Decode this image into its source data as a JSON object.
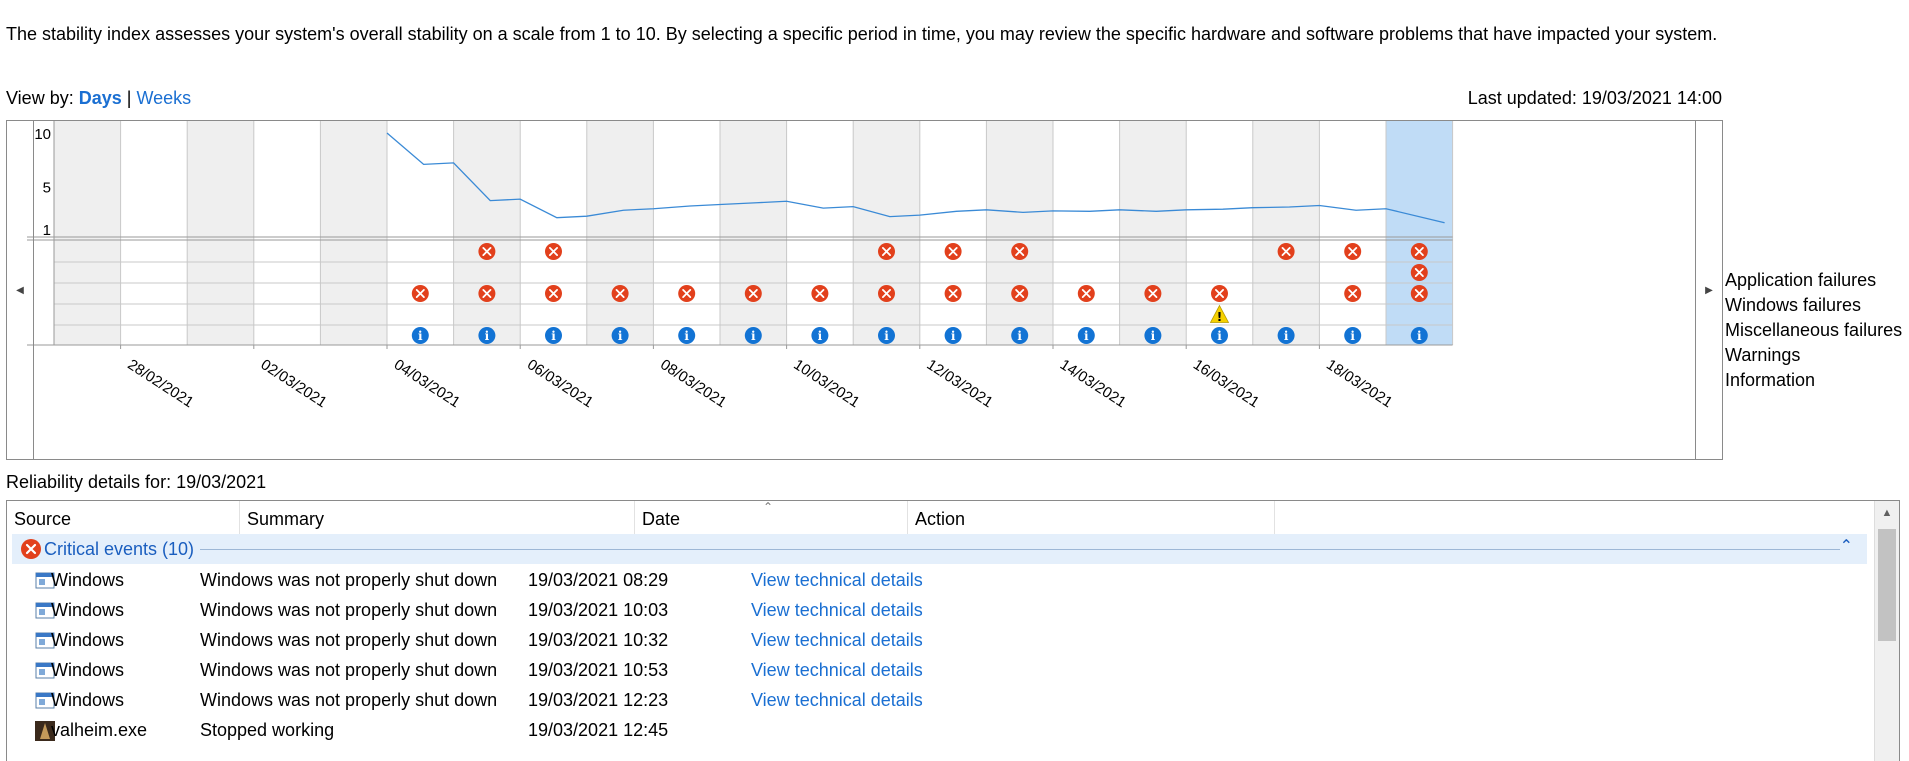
{
  "intro_text": "The stability index assesses your system's overall stability on a scale from 1 to 10. By selecting a specific period in time, you may review the specific hardware and software problems that have impacted your system.",
  "view_by": {
    "label": "View by:",
    "days": "Days",
    "separator": "|",
    "weeks": "Weeks"
  },
  "last_updated": "Last updated: 19/03/2021 14:00",
  "chart": {
    "y_ticks": [
      "10",
      "5",
      "1"
    ],
    "date_labels": [
      "28/02/2021",
      "02/03/2021",
      "04/03/2021",
      "06/03/2021",
      "08/03/2021",
      "10/03/2021",
      "12/03/2021",
      "14/03/2021",
      "16/03/2021",
      "18/03/2021"
    ],
    "row_labels": [
      "Application failures",
      "Windows failures",
      "Miscellaneous failures",
      "Warnings",
      "Information"
    ]
  },
  "chart_data": {
    "type": "line",
    "dates": [
      "27/02/2021",
      "28/02/2021",
      "01/03/2021",
      "02/03/2021",
      "03/03/2021",
      "04/03/2021",
      "05/03/2021",
      "06/03/2021",
      "07/03/2021",
      "08/03/2021",
      "09/03/2021",
      "10/03/2021",
      "11/03/2021",
      "12/03/2021",
      "13/03/2021",
      "14/03/2021",
      "15/03/2021",
      "16/03/2021",
      "17/03/2021",
      "18/03/2021",
      "19/03/2021"
    ],
    "selected_date": "19/03/2021",
    "ylim": [
      1,
      10
    ],
    "stability_index": [
      null,
      null,
      null,
      null,
      null,
      10,
      7.2,
      3.8,
      2.2,
      2.9,
      3.3,
      3.6,
      3.1,
      2.3,
      2.8,
      2.7,
      2.8,
      2.8,
      3.0,
      3.2,
      2.9
    ],
    "events": {
      "Application failures": [
        0,
        0,
        0,
        0,
        0,
        0,
        1,
        1,
        0,
        0,
        0,
        0,
        1,
        1,
        1,
        0,
        0,
        0,
        1,
        1,
        1
      ],
      "Windows failures": [
        0,
        0,
        0,
        0,
        0,
        0,
        0,
        0,
        0,
        0,
        0,
        0,
        0,
        0,
        0,
        0,
        0,
        0,
        0,
        0,
        1
      ],
      "Miscellaneous failures": [
        0,
        0,
        0,
        0,
        0,
        1,
        1,
        1,
        1,
        1,
        1,
        1,
        1,
        1,
        1,
        1,
        1,
        1,
        0,
        1,
        1
      ],
      "Warnings": [
        0,
        0,
        0,
        0,
        0,
        0,
        0,
        0,
        0,
        0,
        0,
        0,
        0,
        0,
        0,
        0,
        0,
        1,
        0,
        0,
        0
      ],
      "Information": [
        0,
        0,
        0,
        0,
        0,
        1,
        1,
        1,
        1,
        1,
        1,
        1,
        1,
        1,
        1,
        1,
        1,
        1,
        1,
        1,
        1
      ]
    }
  },
  "details": {
    "title": "Reliability details for: 19/03/2021",
    "columns": [
      "Source",
      "Summary",
      "Date",
      "Action"
    ],
    "group": {
      "label": "Critical events (10)"
    },
    "rows": [
      {
        "source": "Windows",
        "summary": "Windows was not properly shut down",
        "date": "19/03/2021 08:29",
        "action": "View technical details",
        "icon": "windows-app-icon"
      },
      {
        "source": "Windows",
        "summary": "Windows was not properly shut down",
        "date": "19/03/2021 10:03",
        "action": "View technical details",
        "icon": "windows-app-icon"
      },
      {
        "source": "Windows",
        "summary": "Windows was not properly shut down",
        "date": "19/03/2021 10:32",
        "action": "View technical details",
        "icon": "windows-app-icon"
      },
      {
        "source": "Windows",
        "summary": "Windows was not properly shut down",
        "date": "19/03/2021 10:53",
        "action": "View technical details",
        "icon": "windows-app-icon"
      },
      {
        "source": "Windows",
        "summary": "Windows was not properly shut down",
        "date": "19/03/2021 12:23",
        "action": "View technical details",
        "icon": "windows-app-icon"
      },
      {
        "source": "valheim.exe",
        "summary": "Stopped working",
        "date": "19/03/2021 12:45",
        "action": "",
        "icon": "valheim-app-icon"
      }
    ]
  },
  "colors": {
    "accent": "#1a6fd2",
    "error": "#e2401c",
    "info": "#1273d4",
    "warning": "#f6d100",
    "selected_column": "#c0dcf6",
    "alt_column": "#efefef",
    "line": "#3a8ad6"
  }
}
